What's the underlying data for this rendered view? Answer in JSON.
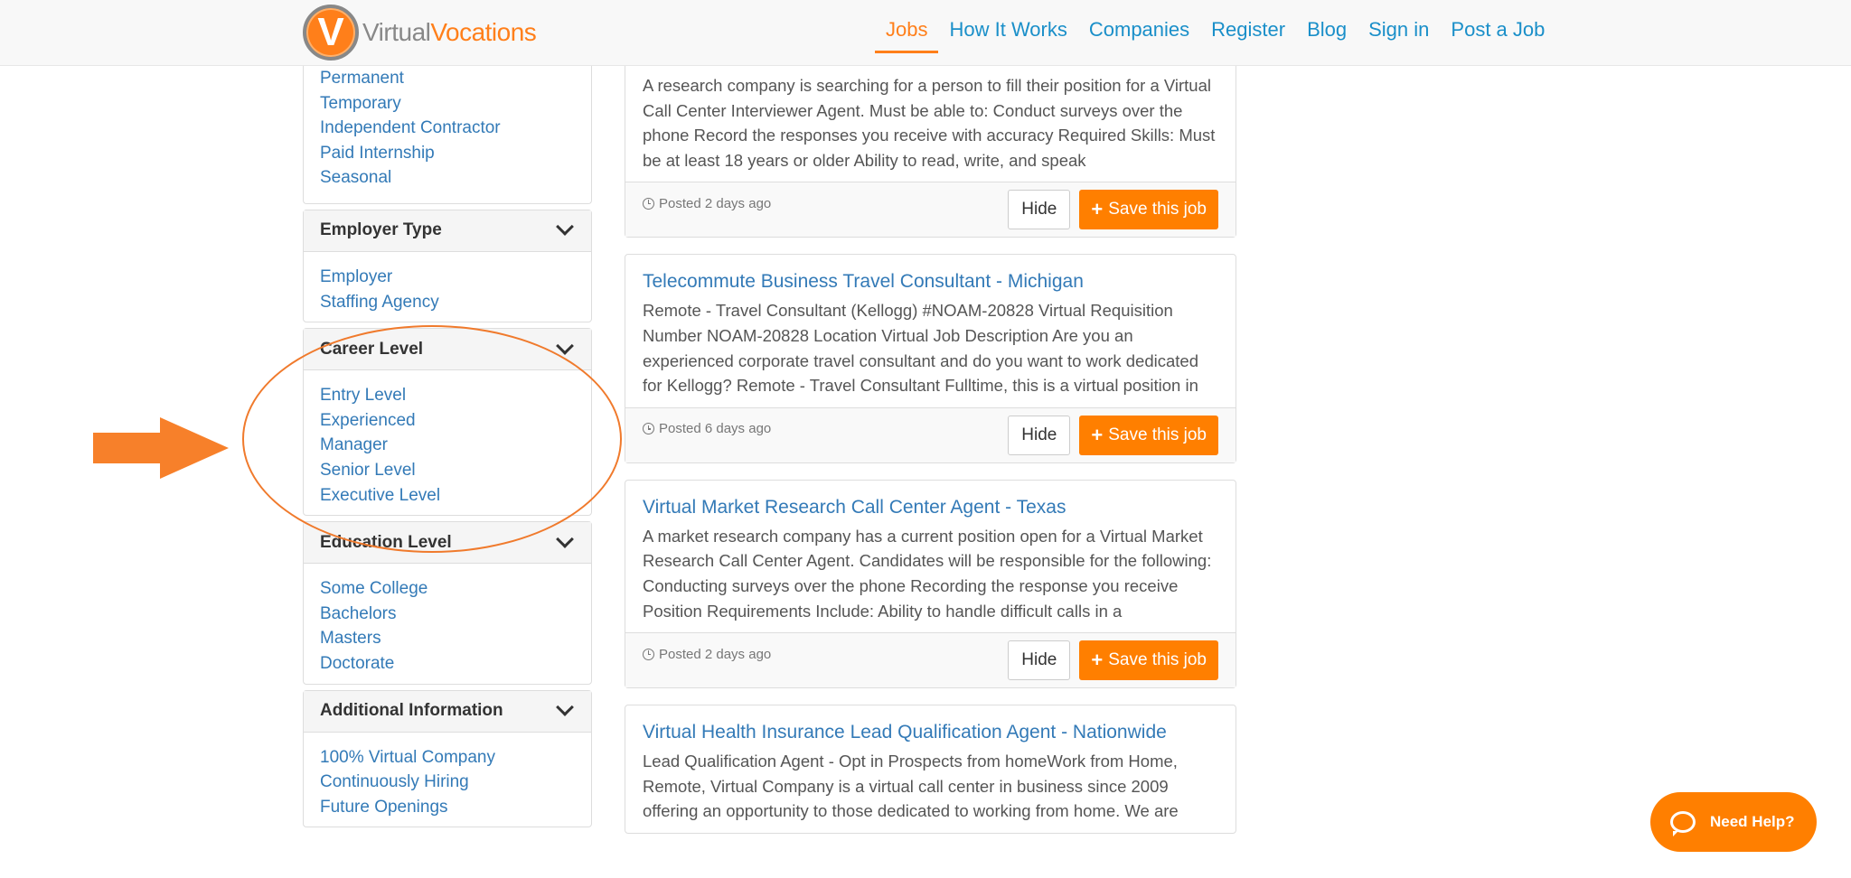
{
  "brand": {
    "logo_letter": "V",
    "name_part1": "Virtual",
    "name_part2": "Vocations"
  },
  "nav": {
    "items": [
      "Jobs",
      "How It Works",
      "Companies",
      "Register",
      "Blog",
      "Sign in",
      "Post a Job"
    ],
    "active": "Jobs"
  },
  "sidebar": {
    "job_type_items": [
      "Permanent",
      "Temporary",
      "Independent Contractor",
      "Paid Internship",
      "Seasonal"
    ],
    "employer_type": {
      "title": "Employer Type",
      "items": [
        "Employer",
        "Staffing Agency"
      ]
    },
    "career_level": {
      "title": "Career Level",
      "items": [
        "Entry Level",
        "Experienced",
        "Manager",
        "Senior Level",
        "Executive Level"
      ]
    },
    "education_level": {
      "title": "Education Level",
      "items": [
        "Some College",
        "Bachelors",
        "Masters",
        "Doctorate"
      ]
    },
    "additional_info": {
      "title": "Additional Information",
      "items": [
        "100% Virtual Company",
        "Continuously Hiring",
        "Future Openings"
      ]
    }
  },
  "jobs": [
    {
      "title": "",
      "description": "A research company is searching for a person to fill their position for a Virtual Call Center Interviewer Agent. Must be able to: Conduct surveys over the phone Record the responses you receive with accuracy Required Skills: Must be at least 18 years or older Ability to read, write, and speak",
      "posted": "Posted 2 days ago"
    },
    {
      "title": "Telecommute Business Travel Consultant - Michigan",
      "description": "Remote - Travel Consultant (Kellogg) #NOAM-20828 Virtual Requisition Number NOAM-20828 Location Virtual Job Description Are you an experienced corporate travel consultant and do you want to work dedicated for Kellogg? Remote - Travel Consultant Fulltime, this is a virtual position in",
      "posted": "Posted 6 days ago"
    },
    {
      "title": "Virtual Market Research Call Center Agent - Texas",
      "description": "A market research company has a current position open for a Virtual Market Research Call Center Agent. Candidates will be responsible for the following: Conducting surveys over the phone Recording the response you receive Position Requirements Include: Ability to handle difficult calls in a",
      "posted": "Posted 2 days ago"
    },
    {
      "title": "Virtual Health Insurance Lead Qualification Agent - Nationwide",
      "description": "Lead Qualification Agent - Opt in Prospects from homeWork from Home, Remote, Virtual Company is a virtual call center in business since 2009 offering an opportunity to those dedicated to working from home. We are",
      "posted": ""
    }
  ],
  "buttons": {
    "hide": "Hide",
    "save": "Save this job"
  },
  "help": {
    "label": "Need Help?"
  },
  "colors": {
    "accent": "#ff7f00",
    "link": "#337ab7",
    "nav_link": "#1a8fc9",
    "annotation": "#f07a2c"
  }
}
